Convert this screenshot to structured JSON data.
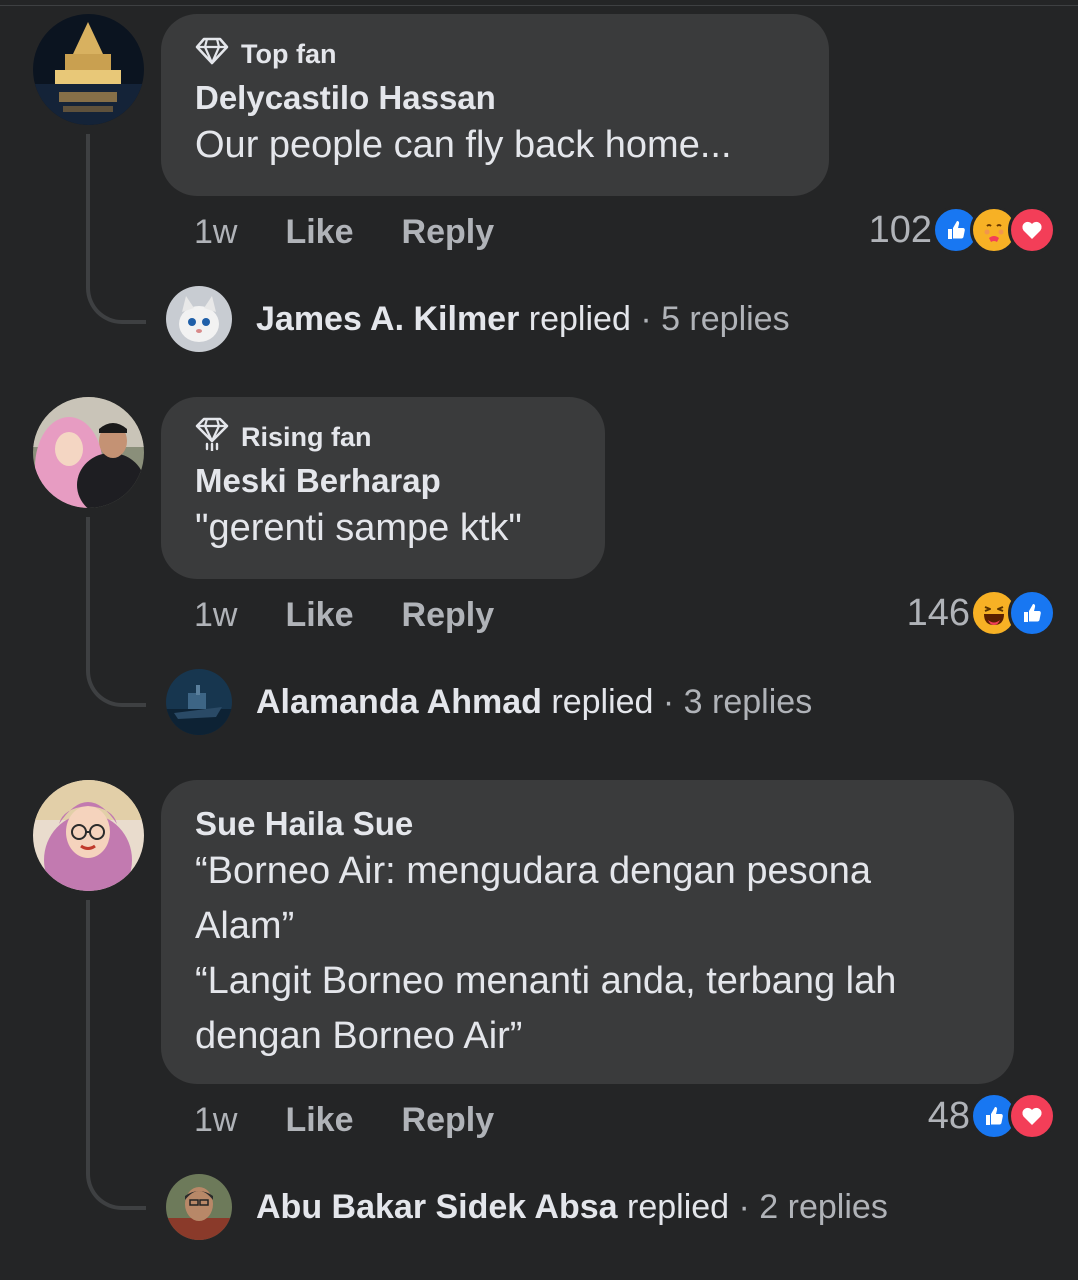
{
  "comments": [
    {
      "badge": "Top fan",
      "badge_icon": "diamond-icon",
      "author": "Delycastilo Hassan",
      "text": "Our people can fly back home...",
      "time": "1w",
      "like": "Like",
      "reply": "Reply",
      "reaction_count": "102",
      "reactions": [
        "like",
        "care",
        "love"
      ],
      "reply_author": "James A. Kilmer",
      "replied": "replied",
      "reply_count": "· 5 replies"
    },
    {
      "badge": "Rising fan",
      "badge_icon": "rising-diamond-icon",
      "author": "Meski Berharap",
      "text": "\"gerenti sampe ktk\"",
      "time": "1w",
      "like": "Like",
      "reply": "Reply",
      "reaction_count": "146",
      "reactions": [
        "haha",
        "like"
      ],
      "reply_author": "Alamanda Ahmad",
      "replied": "replied",
      "reply_count": "· 3 replies"
    },
    {
      "author": "Sue Haila Sue",
      "text_lines": [
        "“Borneo Air: mengudara dengan pesona",
        "Alam”",
        "“Langit Borneo menanti anda, terbang lah",
        "dengan Borneo Air”"
      ],
      "time": "1w",
      "like": "Like",
      "reply": "Reply",
      "reaction_count": "48",
      "reactions": [
        "like",
        "love"
      ],
      "reply_author": "Abu Bakar Sidek Absa",
      "replied": "replied",
      "reply_count": "· 2 replies"
    }
  ],
  "colors": {
    "background": "#242526",
    "bubble": "#3a3b3c",
    "primary_text": "#e4e6eb",
    "secondary_text": "#b0b3b8",
    "like_blue": "#1877f2",
    "love_red": "#f33e58"
  }
}
